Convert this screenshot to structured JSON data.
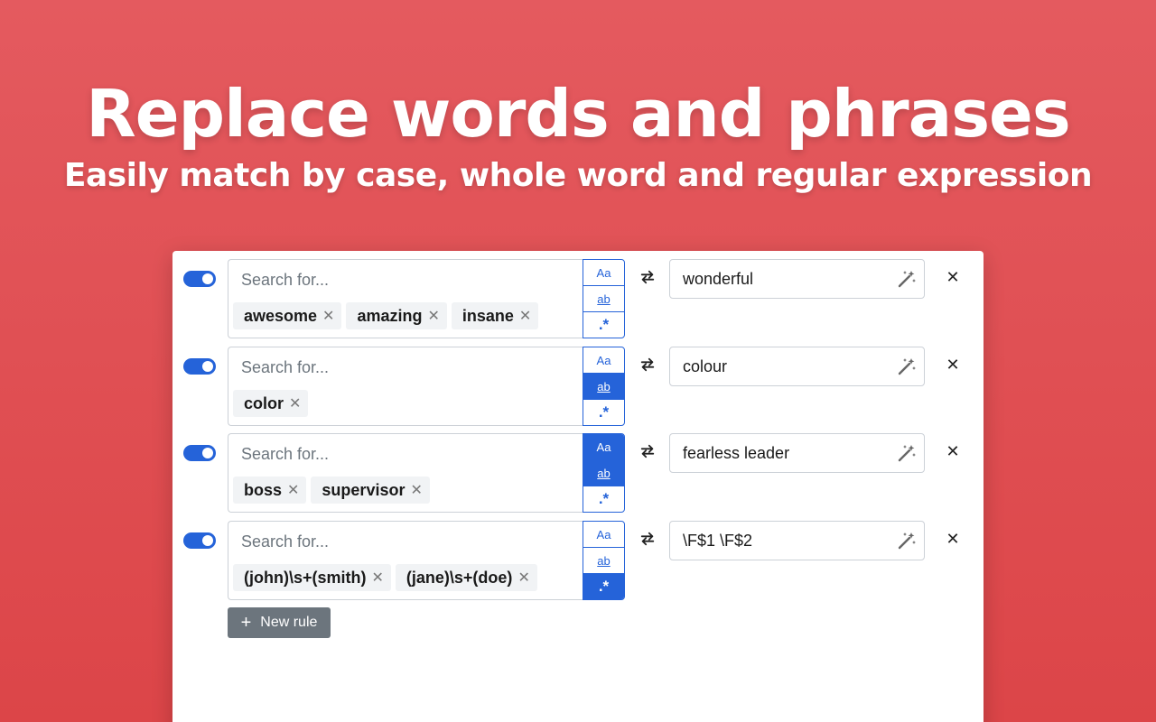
{
  "hero": {
    "title": "Replace words and phrases",
    "subtitle": "Easily match by case, whole word and regular expression"
  },
  "colors": {
    "accent": "#2563d9",
    "background": "#e04f53",
    "button_gray": "#6c757d"
  },
  "option_labels": {
    "case": "Aa",
    "word": "ab",
    "regex": ".*"
  },
  "search_placeholder": "Search for...",
  "rules": [
    {
      "enabled": true,
      "terms": [
        "awesome",
        "amazing",
        "insane"
      ],
      "options": {
        "match_case": false,
        "whole_word": false,
        "regex": false
      },
      "replacement": "wonderful"
    },
    {
      "enabled": true,
      "terms": [
        "color"
      ],
      "options": {
        "match_case": false,
        "whole_word": true,
        "regex": false
      },
      "replacement": "colour"
    },
    {
      "enabled": true,
      "terms": [
        "boss",
        "supervisor"
      ],
      "options": {
        "match_case": true,
        "whole_word": true,
        "regex": false
      },
      "replacement": "fearless leader"
    },
    {
      "enabled": true,
      "terms": [
        "(john)\\s+(smith)",
        "(jane)\\s+(doe)"
      ],
      "options": {
        "match_case": false,
        "whole_word": false,
        "regex": true
      },
      "replacement": "\\F$1 \\F$2"
    }
  ],
  "new_rule_label": "New rule",
  "icons": {
    "swap": "swap-arrows-icon",
    "wand": "magic-wand-icon",
    "remove": "close-icon",
    "tag_remove": "close-icon",
    "add": "plus-icon"
  }
}
